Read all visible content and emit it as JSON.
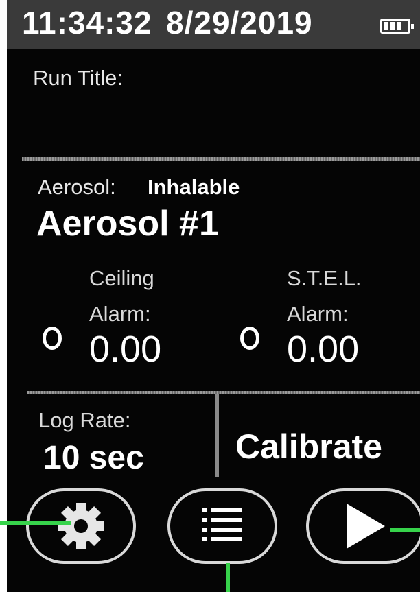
{
  "status_bar": {
    "time": "11:34:32",
    "date": "8/29/2019",
    "battery_icon": "battery-icon"
  },
  "run_title": {
    "label": "Run Title:",
    "value": ""
  },
  "aerosol": {
    "label": "Aerosol:",
    "type": "Inhalable",
    "name": "Aerosol #1"
  },
  "alarms": {
    "ceiling": {
      "title": "Ceiling",
      "sub": "Alarm:",
      "value": "0.00",
      "icon": "radio-icon"
    },
    "stel": {
      "title": "S.T.E.L.",
      "sub": "Alarm:",
      "value": "0.00",
      "icon": "radio-icon"
    }
  },
  "log_rate": {
    "label": "Log Rate:",
    "value": "10 sec"
  },
  "calibrate_label": "Calibrate",
  "softkeys": [
    {
      "name": "settings",
      "icon": "gear-icon"
    },
    {
      "name": "menu",
      "icon": "list-icon"
    },
    {
      "name": "start",
      "icon": "play-icon"
    }
  ],
  "colors": {
    "background": "#050505",
    "status_bar": "#3a3a3a",
    "text": "#ffffff",
    "callout": "#37d34b"
  }
}
